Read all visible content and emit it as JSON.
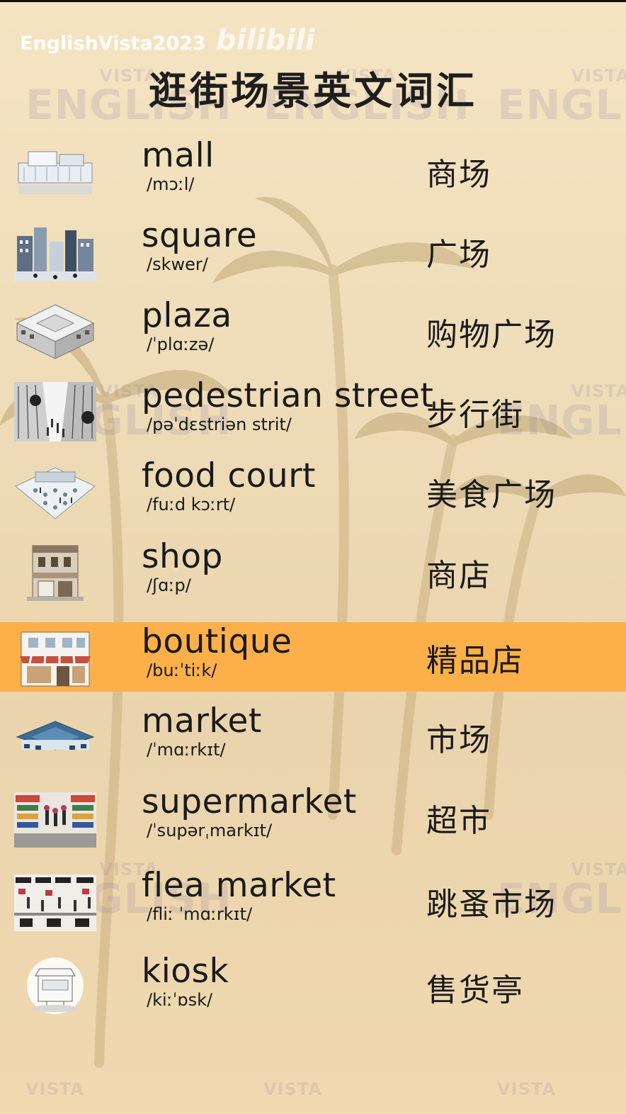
{
  "watermark": {
    "uploader": "EnglishVista2023",
    "site_logo": "bilibili",
    "brand_small": "VISTA",
    "brand_big": "ENGLISH"
  },
  "title": "逛街场景英文词汇",
  "colors": {
    "highlight": "#fdb04a",
    "background": "#efdcb8",
    "text": "#1a1a1a"
  },
  "vocab": [
    {
      "word": "mall",
      "ipa": "/mɔːl/",
      "cn": "商场",
      "icon": "mall-icon",
      "highlighted": false
    },
    {
      "word": "square",
      "ipa": "/skwer/",
      "cn": "广场",
      "icon": "city-square-icon",
      "highlighted": false
    },
    {
      "word": "plaza",
      "ipa": "/ˈplɑːzə/",
      "cn": "购物广场",
      "icon": "plaza-icon",
      "highlighted": false
    },
    {
      "word": "pedestrian street",
      "ipa": "/pəˈdɛstriən strit/",
      "cn": "步行街",
      "icon": "pedestrian-street-icon",
      "highlighted": false
    },
    {
      "word": "food court",
      "ipa": "/fuːd kɔːrt/",
      "cn": "美食广场",
      "icon": "food-court-icon",
      "highlighted": false
    },
    {
      "word": "shop",
      "ipa": "/ʃɑːp/",
      "cn": "商店",
      "icon": "shop-icon",
      "highlighted": false
    },
    {
      "word": "boutique",
      "ipa": "/buːˈtiːk/",
      "cn": "精品店",
      "icon": "boutique-icon",
      "highlighted": true
    },
    {
      "word": "market",
      "ipa": "/ˈmɑːrkɪt/",
      "cn": "市场",
      "icon": "market-icon",
      "highlighted": false
    },
    {
      "word": "supermarket",
      "ipa": "/ˈsupərˌmarkɪt/",
      "cn": "超市",
      "icon": "supermarket-icon",
      "highlighted": false
    },
    {
      "word": "flea market",
      "ipa": "/fliː ˈmɑːrkɪt/",
      "cn": "跳蚤市场",
      "icon": "flea-market-icon",
      "highlighted": false
    },
    {
      "word": "kiosk",
      "ipa": "/kiːˈɒsk/",
      "cn": "售货亭",
      "icon": "kiosk-icon",
      "highlighted": false
    }
  ]
}
